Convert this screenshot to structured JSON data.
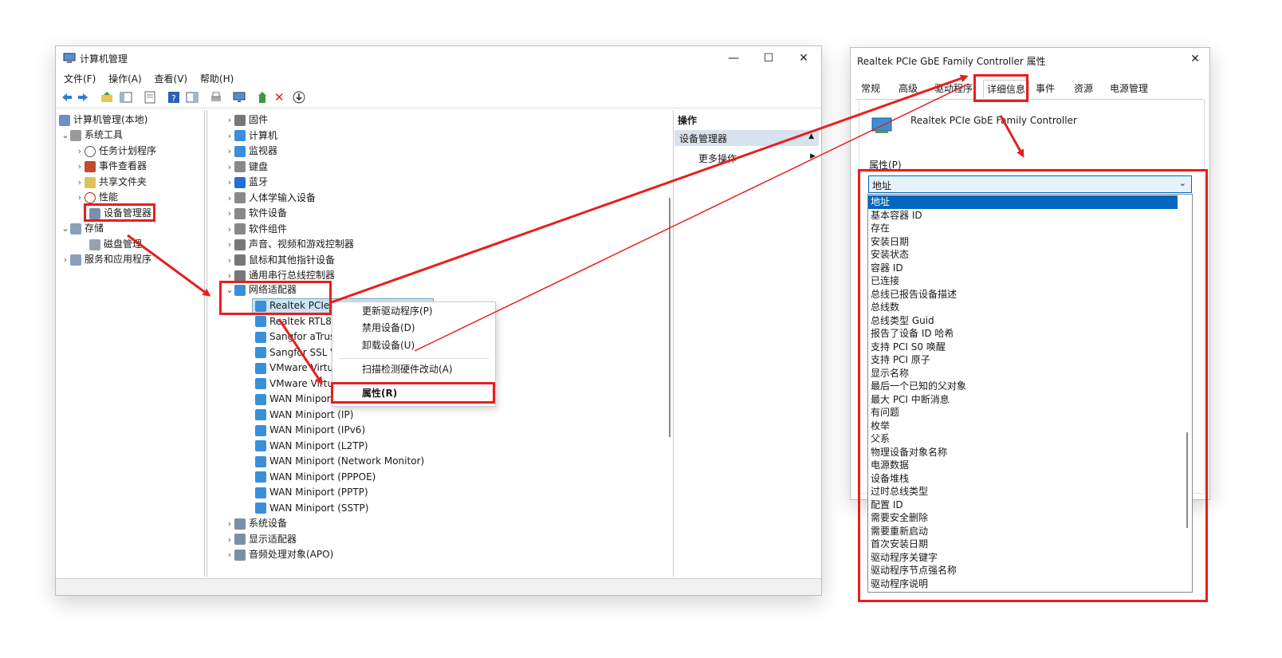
{
  "left_window": {
    "title": "计算机管理",
    "menu": [
      "文件(F)",
      "操作(A)",
      "查看(V)",
      "帮助(H)"
    ],
    "tree": {
      "root": "计算机管理(本地)",
      "system_tools": "系统工具",
      "task_scheduler": "任务计划程序",
      "event_viewer": "事件查看器",
      "shared_folders": "共享文件夹",
      "performance": "性能",
      "device_manager": "设备管理器",
      "storage": "存储",
      "disk_management": "磁盘管理",
      "services_apps": "服务和应用程序"
    },
    "devices": {
      "top": [
        "固件",
        "计算机",
        "监视器",
        "键盘",
        "蓝牙",
        "人体学输入设备",
        "软件设备",
        "软件组件",
        "声音、视频和游戏控制器",
        "鼠标和其他指针设备",
        "通用串行总线控制器"
      ],
      "network_adapters": "网络适配器",
      "adapters": [
        "Realtek PCIe",
        "Realtek RTL88",
        "Sangfor aTrus",
        "Sangfor SSL V",
        "VMware Virtu",
        "VMware Virtu",
        "WAN Minipor",
        "WAN Miniport (IP)",
        "WAN Miniport (IPv6)",
        "WAN Miniport (L2TP)",
        "WAN Miniport (Network Monitor)",
        "WAN Miniport (PPPOE)",
        "WAN Miniport (PPTP)",
        "WAN Miniport (SSTP)"
      ],
      "bottom": [
        "系统设备",
        "显示适配器",
        "音频处理对象(APO)"
      ]
    },
    "context_menu": {
      "update_driver": "更新驱动程序(P)",
      "disable": "禁用设备(D)",
      "uninstall": "卸载设备(U)",
      "scan": "扫描检测硬件改动(A)",
      "properties": "属性(R)"
    },
    "actions": {
      "header": "操作",
      "section": "设备管理器",
      "more": "更多操作"
    }
  },
  "right_window": {
    "title": "Realtek PCIe GbE Family Controller 属性",
    "tabs": [
      "常规",
      "高级",
      "驱动程序",
      "详细信息",
      "事件",
      "资源",
      "电源管理"
    ],
    "active_tab_index": 3,
    "device_name": "Realtek PCIe GbE Family Controller",
    "property_label": "属性(P)",
    "selected_property": "地址",
    "property_options": [
      "地址",
      "基本容器 ID",
      "存在",
      "安装日期",
      "安装状态",
      "容器 ID",
      "已连接",
      "总线已报告设备描述",
      "总线数",
      "总线类型 Guid",
      "报告了设备 ID 哈希",
      "支持 PCI S0 唤醒",
      "支持 PCI 原子",
      "显示名称",
      "最后一个已知的父对象",
      "最大 PCI 中断消息",
      "有问题",
      "枚举",
      "父系",
      "物理设备对象名称",
      "电源数据",
      "设备堆栈",
      "过时总线类型",
      "配置 ID",
      "需要安全删除",
      "需要重新启动",
      "首次安装日期",
      "驱动程序关键字",
      "驱动程序节点强名称",
      "驱动程序说明"
    ]
  },
  "colors": {
    "annotation_red": "#e81e1e",
    "selection_blue": "#0067c0",
    "highlight_bg": "#cce4f7"
  },
  "icons": [
    "computer-management-icon",
    "back-arrow-icon",
    "forward-arrow-icon",
    "help-icon",
    "delete-x-icon",
    "download-icon",
    "network-adapter-icon",
    "bluetooth-icon",
    "chevron-right-icon",
    "chevron-down-icon"
  ]
}
